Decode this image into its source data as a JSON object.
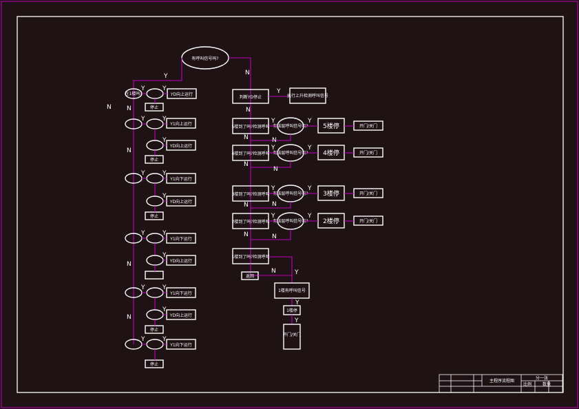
{
  "start": "有呼叫信号吗?",
  "yes": "Y",
  "no": "N",
  "left_chain": [
    {
      "decision": "在1楼吗?",
      "action": "YD向上运行",
      "note": "停止"
    },
    {
      "decision": "在2楼吗?",
      "action": "Y1向上运行"
    },
    {
      "decision": "在2楼吗?",
      "action": "YD向上运行",
      "note": "停止"
    },
    {
      "decision": "在3楼吗?",
      "action": "Y1向下运行"
    },
    {
      "decision": "在3楼吗?",
      "action": "YD向上运行",
      "note": "停止"
    },
    {
      "decision": "在4楼吗?",
      "action": "Y1向下运行"
    },
    {
      "decision": "在4楼吗?",
      "action": "YD向上运行"
    },
    {
      "decision": "在5楼吗?",
      "action": "Y1向下运行",
      "note": "停止"
    },
    {
      "decision": "在5楼吗?",
      "action": "YD向上运行",
      "note": "停止"
    },
    {
      "decision": "在5楼吗?",
      "action": "Y1向下运行",
      "note": "停止"
    }
  ],
  "right_top": {
    "check": "判断YD停止",
    "result": "执行上升检测呼叫信号"
  },
  "right_floors": [
    {
      "check": "5楼到了吗?检测呼叫",
      "confirm": "有该层呼叫信号吗?",
      "stop": "5楼停",
      "open": "开门/关门"
    },
    {
      "check": "4楼到了吗?检测呼叫",
      "confirm": "有该层呼叫信号吗?",
      "stop": "4楼停",
      "open": "开门/关门"
    },
    {
      "check": "3楼到了吗?检测呼叫",
      "confirm": "有该层呼叫信号吗?",
      "stop": "3楼停",
      "open": "开门/关门"
    },
    {
      "check": "2楼到了吗?检测呼叫",
      "confirm": "有该层呼叫信号吗?",
      "stop": "2楼停",
      "open": "开门/关门"
    }
  ],
  "bottom": {
    "check": "1楼到了吗?检测呼叫",
    "back": "返回",
    "confirm": "1楼有呼叫信号",
    "stop": "1楼停",
    "open": "开门/关门"
  },
  "title_block": {
    "title": "主程序流程图",
    "scale": "分一张",
    "r1": "比例",
    "r2": "数量"
  }
}
